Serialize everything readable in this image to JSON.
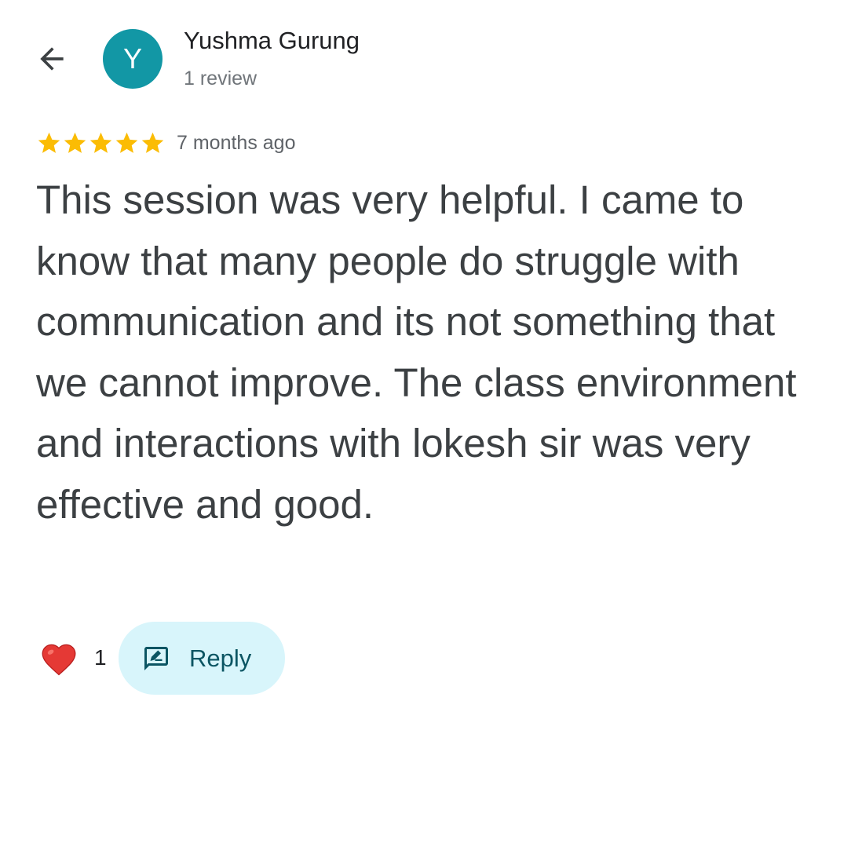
{
  "reviewer": {
    "avatar_letter": "Y",
    "avatar_color": "#1297a5",
    "name": "Yushma Gurung",
    "review_count": "1 review"
  },
  "review": {
    "rating": 5,
    "max_rating": 5,
    "star_color": "#fbbc04",
    "time_ago": "7 months ago",
    "text": "This session was very helpful. I came to know that many people do struggle with communication and its not something that we cannot improve. The class environment and interactions with lokesh sir was very effective and good."
  },
  "actions": {
    "like_icon": "heart-icon",
    "like_count": "1",
    "reply_icon": "reply-icon",
    "reply_label": "Reply"
  },
  "navigation": {
    "back_icon": "arrow-back-icon"
  }
}
